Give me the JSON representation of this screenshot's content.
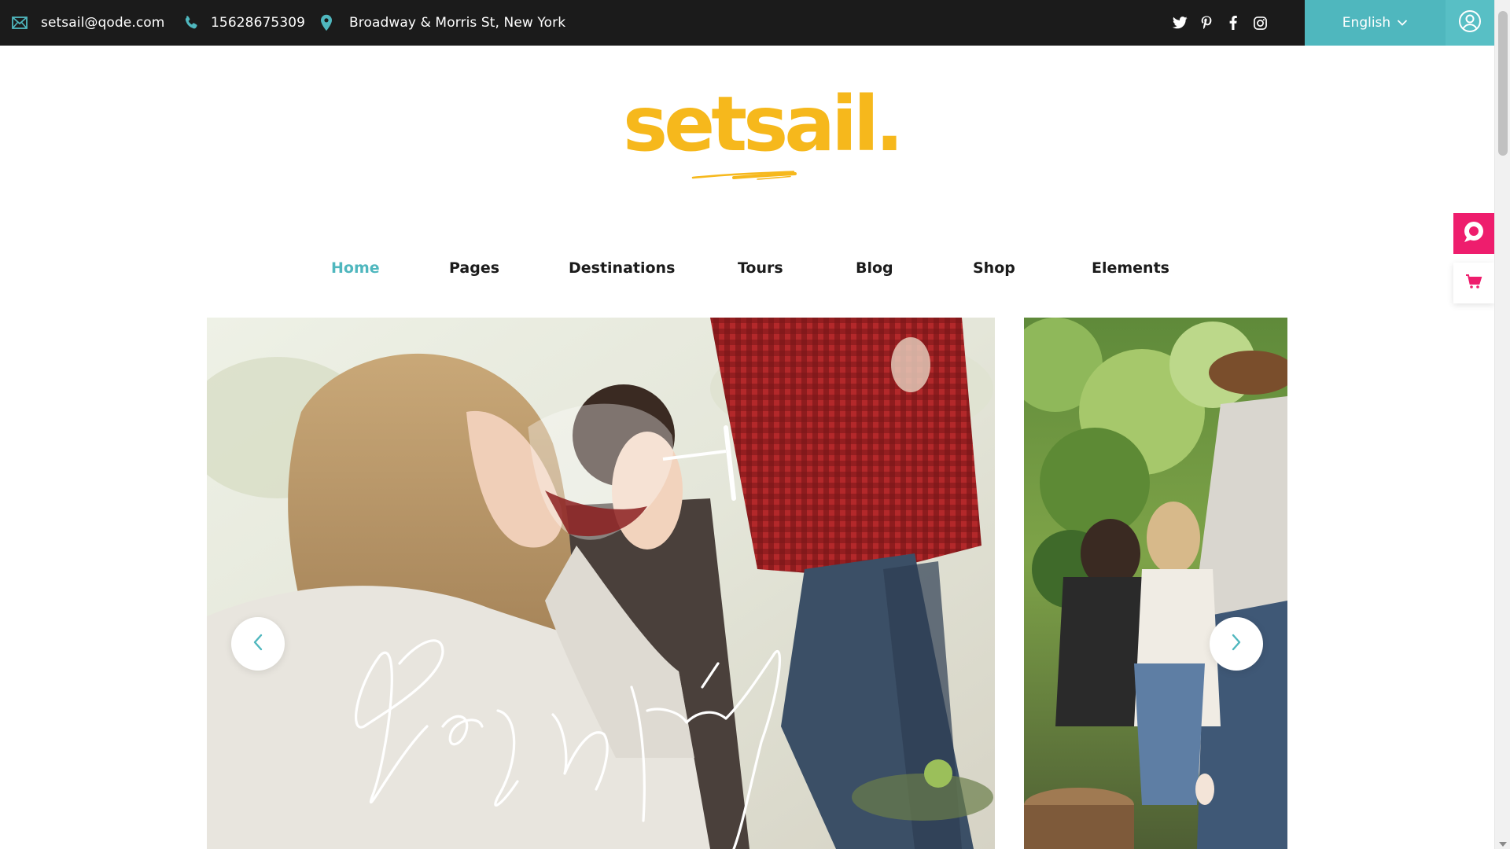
{
  "topbar": {
    "email": "setsail@qode.com",
    "phone": "15628675309",
    "address": "Broadway & Morris St, New York",
    "language": "English",
    "social": [
      "twitter-icon",
      "pinterest-icon",
      "facebook-icon",
      "instagram-icon"
    ]
  },
  "logo": {
    "text": "setsail."
  },
  "nav": {
    "items": [
      {
        "label": "Home",
        "active": true
      },
      {
        "label": "Pages"
      },
      {
        "label": "Destinations"
      },
      {
        "label": "Tours"
      },
      {
        "label": "Blog"
      },
      {
        "label": "Shop"
      },
      {
        "label": "Elements"
      }
    ]
  },
  "slider": {
    "prev_icon": "chevron-left-icon",
    "next_icon": "chevron-right-icon"
  },
  "widgets": {
    "chat_icon": "chat-bubble-icon",
    "cart_icon": "shopping-cart-icon"
  },
  "colors": {
    "accent": "#4fb7be",
    "logo": "#f6b81c",
    "topbar_bg": "#1b1b1b",
    "chat_widget": "#ee1d6d"
  }
}
